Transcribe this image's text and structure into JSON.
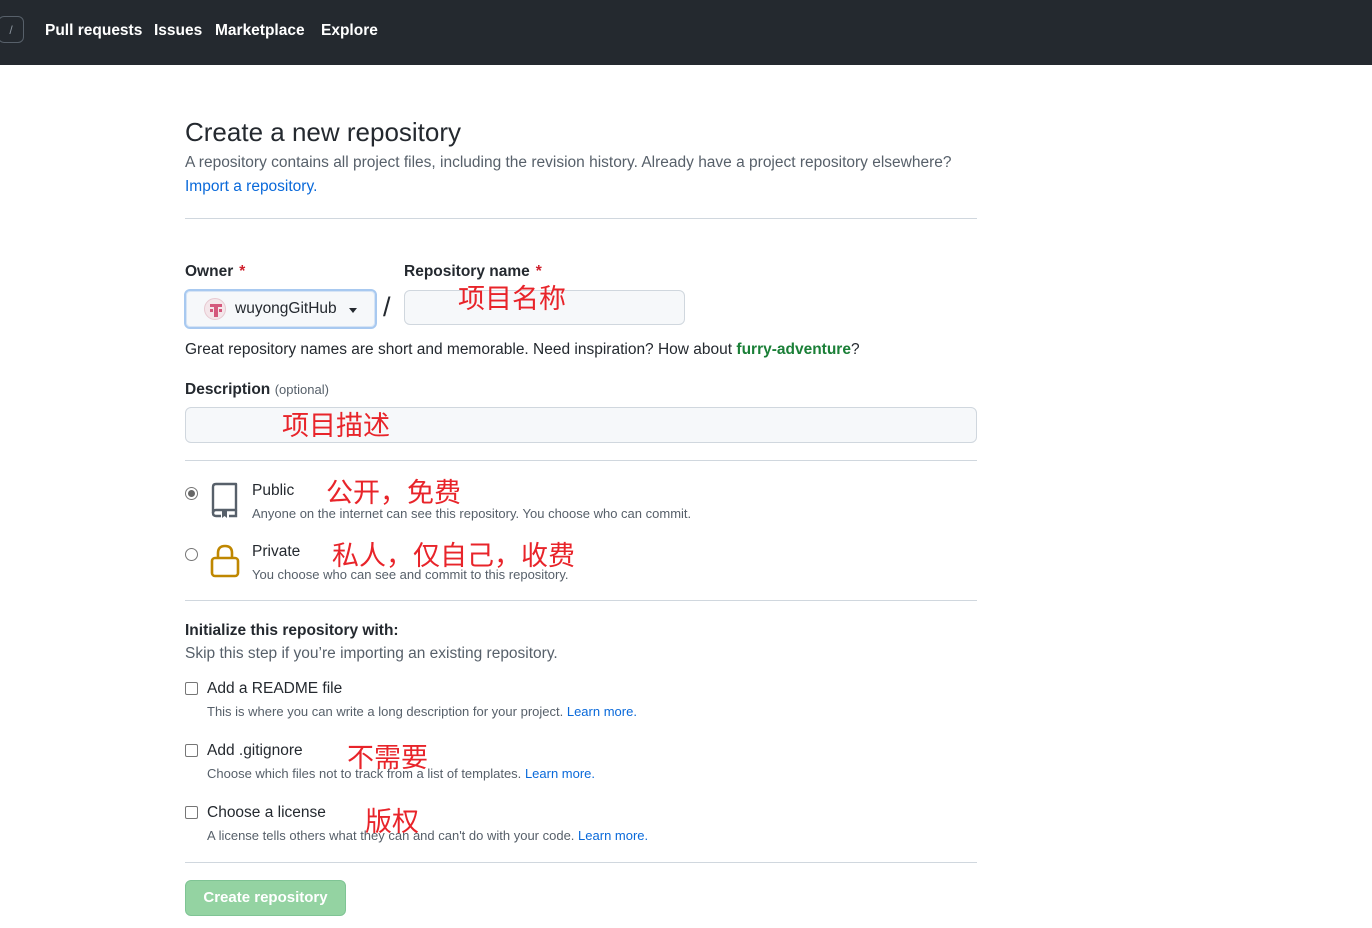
{
  "topnav": {
    "slash_key": "/",
    "links": [
      "Pull requests",
      "Issues",
      "Marketplace",
      "Explore"
    ]
  },
  "page": {
    "title": "Create a new repository",
    "subtitle": "A repository contains all project files, including the revision history. Already have a project repository elsewhere?",
    "import_link": "Import a repository."
  },
  "form": {
    "owner_label": "Owner",
    "required_mark": "*",
    "owner_value": "wuyongGitHub",
    "slash": "/",
    "repo_name_label": "Repository name",
    "repo_name_value": "",
    "hint_prefix": "Great repository names are short and memorable. Need inspiration? How about ",
    "hint_suggestion": "furry-adventure",
    "hint_suffix": "?",
    "description_label": "Description",
    "description_optional": "(optional)",
    "description_value": ""
  },
  "visibility": {
    "selected": "public",
    "public_title": "Public",
    "public_desc": "Anyone on the internet can see this repository. You choose who can commit.",
    "private_title": "Private",
    "private_desc": "You choose who can see and commit to this repository."
  },
  "initialize": {
    "heading": "Initialize this repository with:",
    "subheading": "Skip this step if you’re importing an existing repository.",
    "learn_more": "Learn more.",
    "options": [
      {
        "title": "Add a README file",
        "desc": "This is where you can write a long description for your project.",
        "checked": false
      },
      {
        "title": "Add .gitignore",
        "desc": "Choose which files not to track from a list of templates.",
        "checked": false
      },
      {
        "title": "Choose a license",
        "desc": "A license tells others what they can and can't do with your code.",
        "checked": false
      }
    ]
  },
  "submit_label": "Create repository",
  "annotations": {
    "repo_name": "项目名称",
    "description": "项目描述",
    "public": "公开，免费",
    "private": "私人，仅自己，收费",
    "gitignore": "不需要",
    "license": "版权"
  },
  "colors": {
    "header_bg": "#24292f",
    "link": "#0969da",
    "suggestion": "#1a7f37",
    "required": "#cf222e",
    "annotation": "#e8242a",
    "create_button_disabled": "#94d3a2",
    "lock_icon": "#bf8700"
  },
  "icons": {
    "public": "repo-icon",
    "private": "lock-icon",
    "owner_avatar": "avatar"
  }
}
